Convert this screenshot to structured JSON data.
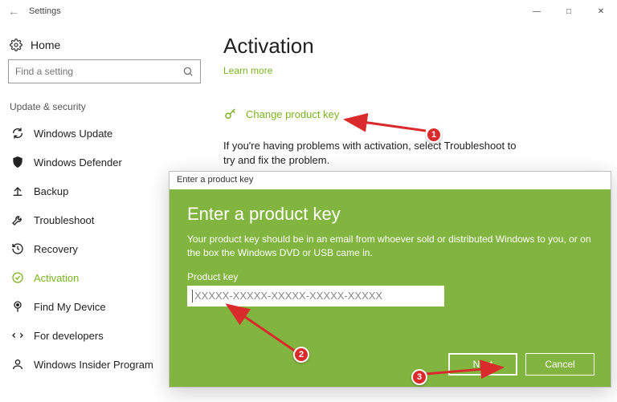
{
  "window": {
    "title": "Settings"
  },
  "sidebar": {
    "home": "Home",
    "search_placeholder": "Find a setting",
    "group_label": "Update & security",
    "items": [
      {
        "label": "Windows Update"
      },
      {
        "label": "Windows Defender"
      },
      {
        "label": "Backup"
      },
      {
        "label": "Troubleshoot"
      },
      {
        "label": "Recovery"
      },
      {
        "label": "Activation"
      },
      {
        "label": "Find My Device"
      },
      {
        "label": "For developers"
      },
      {
        "label": "Windows Insider Program"
      }
    ]
  },
  "page": {
    "title": "Activation",
    "learn_more": "Learn more",
    "change_key": "Change product key",
    "trouble_text": "If you're having problems with activation, select Troubleshoot to try and fix the problem."
  },
  "dialog": {
    "title_small": "Enter a product key",
    "heading": "Enter a product key",
    "desc": "Your product key should be in an email from whoever sold or distributed Windows to you, or on the box the Windows DVD or USB came in.",
    "field_label": "Product key",
    "placeholder": "XXXXX-XXXXX-XXXXX-XXXXX-XXXXX",
    "next": "Next",
    "cancel": "Cancel"
  },
  "annotations": {
    "n1": "1",
    "n2": "2",
    "n3": "3"
  }
}
